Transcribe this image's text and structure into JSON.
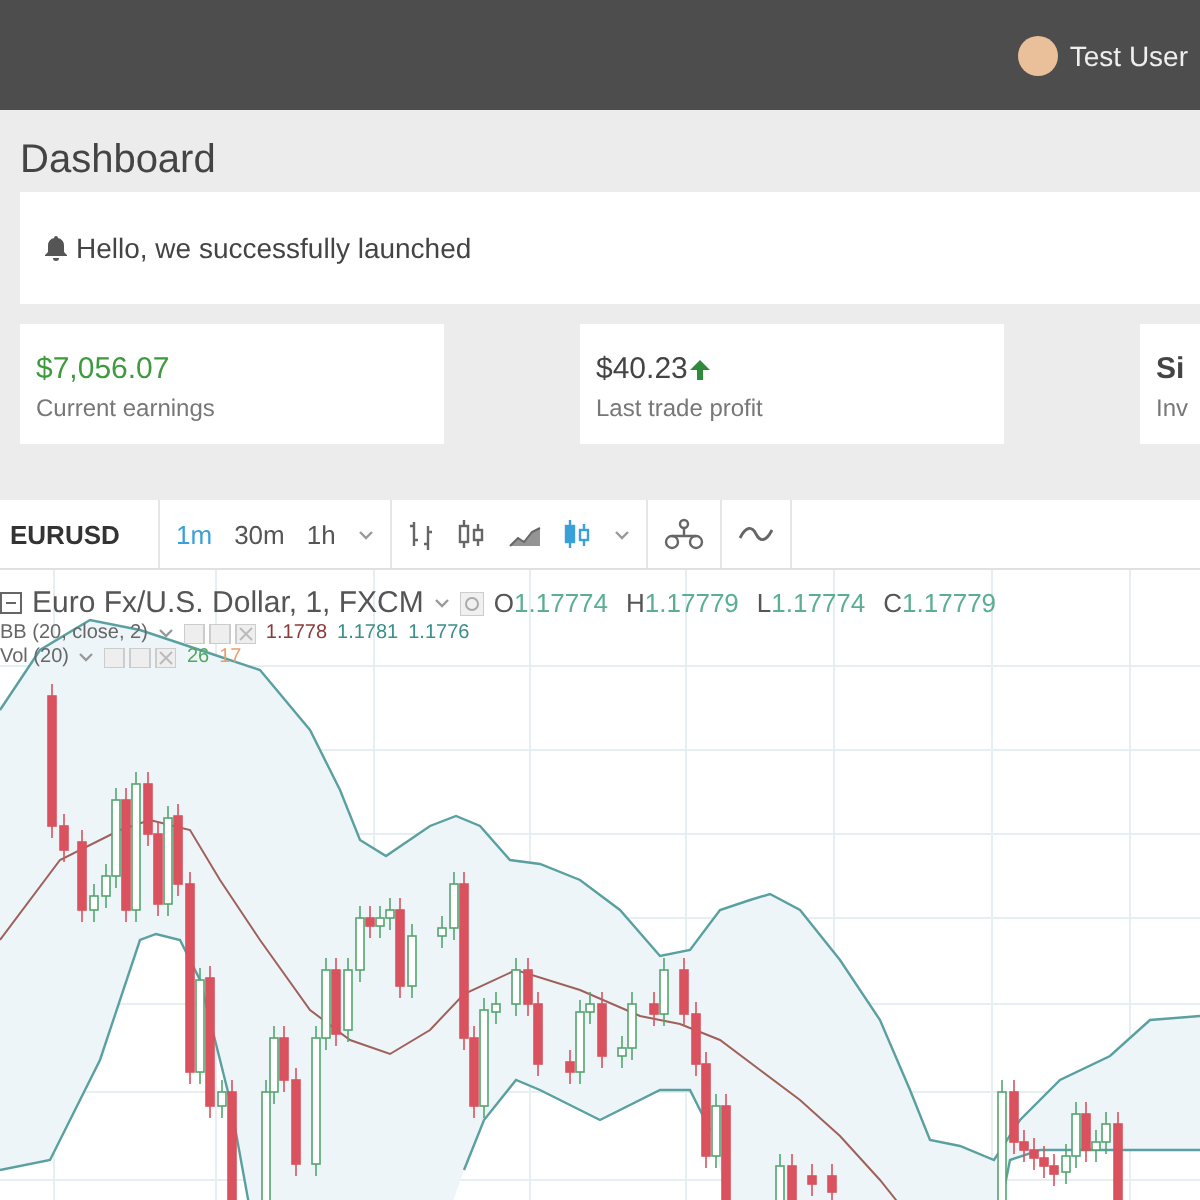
{
  "header": {
    "user_name": "Test User"
  },
  "page_title": "Dashboard",
  "alert": {
    "text": "Hello, we successfully launched"
  },
  "stats": [
    {
      "kind": "positive",
      "value": "$7,056.07",
      "label": "Current earnings"
    },
    {
      "kind": "up",
      "value": "$40.23",
      "label": "Last trade profit"
    },
    {
      "kind": "plain",
      "value": "Si",
      "label": "Inv"
    }
  ],
  "toolbar": {
    "symbol": "EURUSD",
    "intervals": [
      {
        "label": "1m",
        "selected": true
      },
      {
        "label": "30m",
        "selected": false
      },
      {
        "label": "1h",
        "selected": false
      }
    ],
    "chart_styles": [
      {
        "kind": "bars",
        "selected": false
      },
      {
        "kind": "candles",
        "selected": false
      },
      {
        "kind": "area",
        "selected": false
      },
      {
        "kind": "hollow",
        "selected": true
      }
    ]
  },
  "legend": {
    "title": "Euro Fx/U.S. Dollar, 1, FXCM",
    "ohlc": [
      {
        "label": "O",
        "value": "1.17774"
      },
      {
        "label": "H",
        "value": "1.17779"
      },
      {
        "label": "L",
        "value": "1.17774"
      },
      {
        "label": "C",
        "value": "1.17779"
      }
    ],
    "indicators": [
      {
        "label": "BB (20, close, 2)",
        "values": [
          {
            "text": "1.1778",
            "color": "#8b3a3a"
          },
          {
            "text": "1.1781",
            "color": "#3a8f8a"
          },
          {
            "text": "1.1776",
            "color": "#3a8f8a"
          }
        ]
      },
      {
        "label": "Vol (20)",
        "values": [
          {
            "text": "26",
            "color": "#53a65f"
          },
          {
            "text": "17",
            "color": "#e8a06a"
          }
        ]
      }
    ]
  }
}
